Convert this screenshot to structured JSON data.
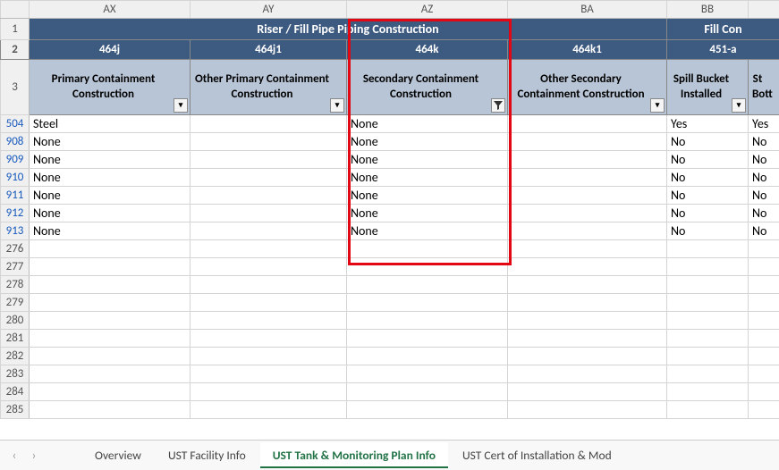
{
  "columns": [
    "AX",
    "AY",
    "AZ",
    "BA",
    "BB"
  ],
  "row1_title1": "Riser / Fill Pipe Piping Construction",
  "row1_title2": "Fill Con",
  "codes": {
    "ax": "464j",
    "ay": "464j1",
    "az": "464k",
    "ba": "464k1",
    "bb": "451-a"
  },
  "subheaders": {
    "ax": "Primary Containment Construction",
    "ay": "Other Primary Containment Construction",
    "az": "Secondary Containment Construction",
    "ba": "Other Secondary Containment Construction",
    "bb": "Spill Bucket Installed",
    "bc_a": "St",
    "bc_b": "Bott"
  },
  "data_rows": [
    {
      "n": "504",
      "ax": "Steel",
      "ay": "",
      "az": "None",
      "ba": "",
      "bb": "Yes",
      "bc": "Yes"
    },
    {
      "n": "908",
      "ax": "None",
      "ay": "",
      "az": "None",
      "ba": "",
      "bb": "No",
      "bc": "No"
    },
    {
      "n": "909",
      "ax": "None",
      "ay": "",
      "az": "None",
      "ba": "",
      "bb": "No",
      "bc": "No"
    },
    {
      "n": "910",
      "ax": "None",
      "ay": "",
      "az": "None",
      "ba": "",
      "bb": "No",
      "bc": "No"
    },
    {
      "n": "911",
      "ax": "None",
      "ay": "",
      "az": "None",
      "ba": "",
      "bb": "No",
      "bc": "No"
    },
    {
      "n": "912",
      "ax": "None",
      "ay": "",
      "az": "None",
      "ba": "",
      "bb": "No",
      "bc": "No"
    },
    {
      "n": "913",
      "ax": "None",
      "ay": "",
      "az": "None",
      "ba": "",
      "bb": "No",
      "bc": "No"
    }
  ],
  "empty_rows": [
    "276",
    "277",
    "278",
    "279",
    "280",
    "281",
    "282",
    "283",
    "284",
    "285"
  ],
  "tabs": [
    "Overview",
    "UST Facility Info",
    "UST Tank & Monitoring Plan Info",
    "UST Cert of Installation & Mod"
  ],
  "active_tab_index": 2
}
